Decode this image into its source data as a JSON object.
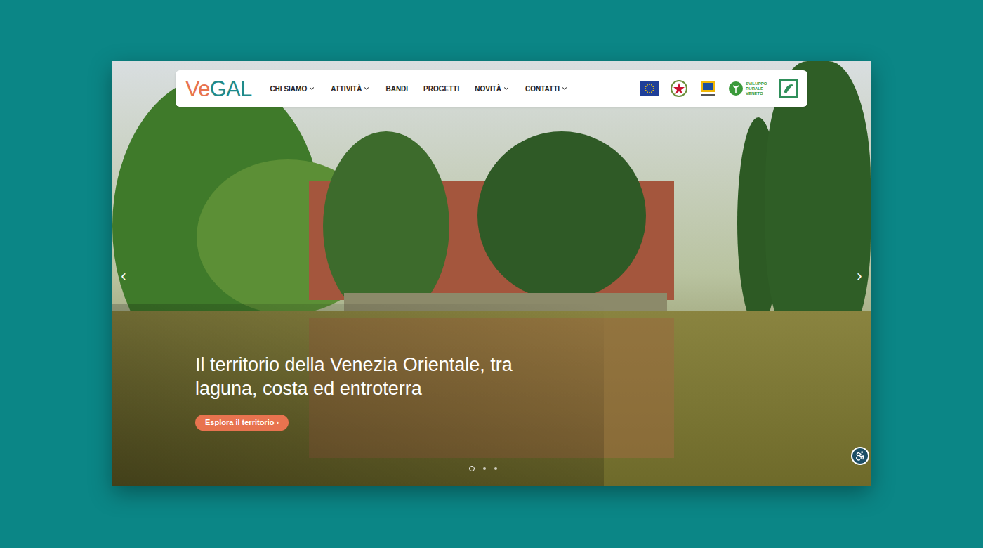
{
  "logo": {
    "prefix": "Ve",
    "suffix": "GAL"
  },
  "nav": [
    {
      "label": "CHI SIAMO",
      "dropdown": true
    },
    {
      "label": "ATTIVITÀ",
      "dropdown": true
    },
    {
      "label": "BANDI",
      "dropdown": false
    },
    {
      "label": "PROGETTI",
      "dropdown": false
    },
    {
      "label": "NOVITÀ",
      "dropdown": true
    },
    {
      "label": "CONTATTI",
      "dropdown": true
    }
  ],
  "partner_logos": {
    "rural_label": "SVILUPPO RURALE VENETO"
  },
  "hero": {
    "title": "Il territorio della Venezia Orientale, tra laguna, costa ed entroterra",
    "button": "Esplora il territorio ›",
    "prev": "‹",
    "next": "›"
  },
  "slides": [
    {
      "selected": true
    },
    {
      "selected": false
    },
    {
      "selected": false
    }
  ]
}
